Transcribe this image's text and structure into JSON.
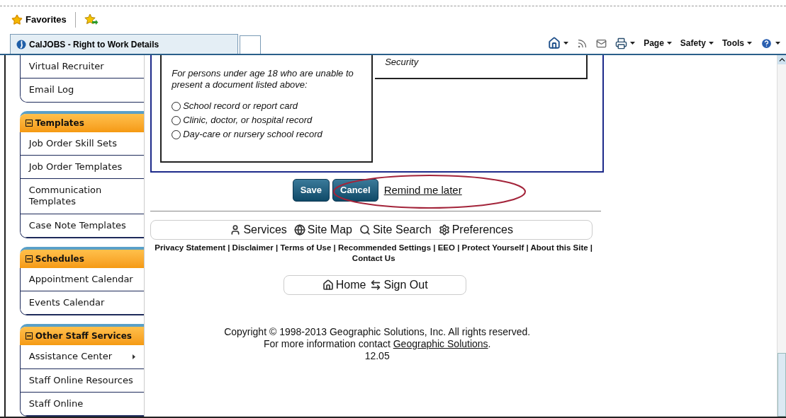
{
  "favorites_bar": {
    "label": "Favorites"
  },
  "tab": {
    "title": "CalJOBS - Right to Work Details"
  },
  "toolbar": {
    "menus": [
      "Page",
      "Safety",
      "Tools"
    ]
  },
  "sidebar": {
    "top_items": [
      {
        "label": "Virtual Recruiter",
        "has_submenu": false
      },
      {
        "label": "Email Log",
        "has_submenu": false
      }
    ],
    "sections": [
      {
        "title": "Templates",
        "expanded": true,
        "items": [
          {
            "label": "Job Order Skill Sets",
            "has_submenu": false
          },
          {
            "label": "Job Order Templates",
            "has_submenu": false
          },
          {
            "label": "Communication Templates",
            "has_submenu": false
          },
          {
            "label": "Case Note Templates",
            "has_submenu": false
          }
        ]
      },
      {
        "title": "Schedules",
        "expanded": true,
        "items": [
          {
            "label": "Appointment Calendar",
            "has_submenu": false
          },
          {
            "label": "Events Calendar",
            "has_submenu": false
          }
        ]
      },
      {
        "title": "Other Staff Services",
        "expanded": true,
        "items": [
          {
            "label": "Assistance Center",
            "has_submenu": true
          },
          {
            "label": "Staff Online Resources",
            "has_submenu": false
          },
          {
            "label": "Staff Online",
            "has_submenu": false
          }
        ]
      }
    ]
  },
  "form": {
    "instruction": "For persons under age 18 who are unable to present a document listed above:",
    "options": [
      {
        "label": "School record or report card",
        "selected": false
      },
      {
        "label": "Clinic, doctor, or hospital record",
        "selected": false
      },
      {
        "label": "Day-care or nursery school record",
        "selected": false
      }
    ],
    "right_cell": "Security"
  },
  "actions": {
    "buttons": [
      "Save",
      "Cancel"
    ],
    "link": "Remind me later",
    "annotation_circled": true
  },
  "nav": [
    {
      "kind": "services",
      "label": "Services"
    },
    {
      "kind": "sitemap",
      "label": "Site Map"
    },
    {
      "kind": "search",
      "label": "Site Search"
    },
    {
      "kind": "preferences",
      "label": "Preferences"
    }
  ],
  "footer_links": {
    "separator": "|",
    "links": [
      "Privacy Statement",
      "Disclaimer",
      "Terms of Use",
      "Recommended Settings",
      "EEO",
      "Protect Yourself",
      "About this Site",
      "Contact Us"
    ]
  },
  "home_nav": [
    {
      "kind": "home",
      "label": "Home"
    },
    {
      "kind": "signout",
      "label": "Sign Out"
    }
  ],
  "copyright": {
    "line1": "Copyright © 1998-2013 Geographic Solutions, Inc. All rights reserved.",
    "line2": "For more information contact",
    "link": "Geographic Solutions",
    "after_link": ".",
    "version": "12.05"
  }
}
